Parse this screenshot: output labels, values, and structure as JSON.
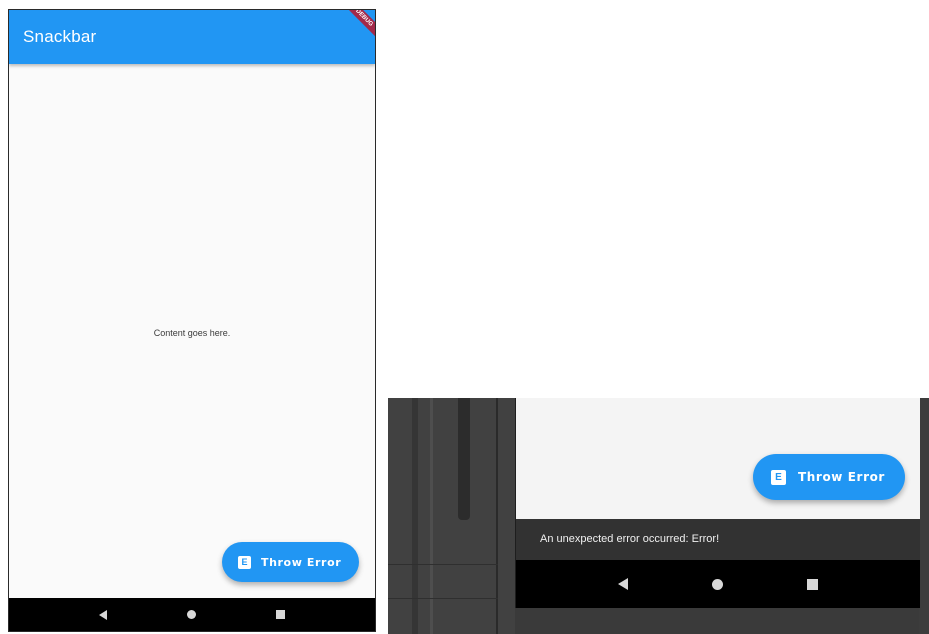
{
  "app": {
    "title": "Snackbar",
    "debug_banner": "DEBUG"
  },
  "body": {
    "content_text": "Content goes here."
  },
  "fab": {
    "label": "Throw Error",
    "icon_letter": "E"
  },
  "snackbar": {
    "message": "An unexpected error occurred: Error!"
  },
  "navigation": {
    "back": "back-icon",
    "home": "home-icon",
    "recents": "recents-icon"
  },
  "colors": {
    "primary": "#2196f3",
    "background": "#fafafa",
    "snackbar": "#323232",
    "navbar": "#000000",
    "debug_banner": "#a3294a"
  }
}
